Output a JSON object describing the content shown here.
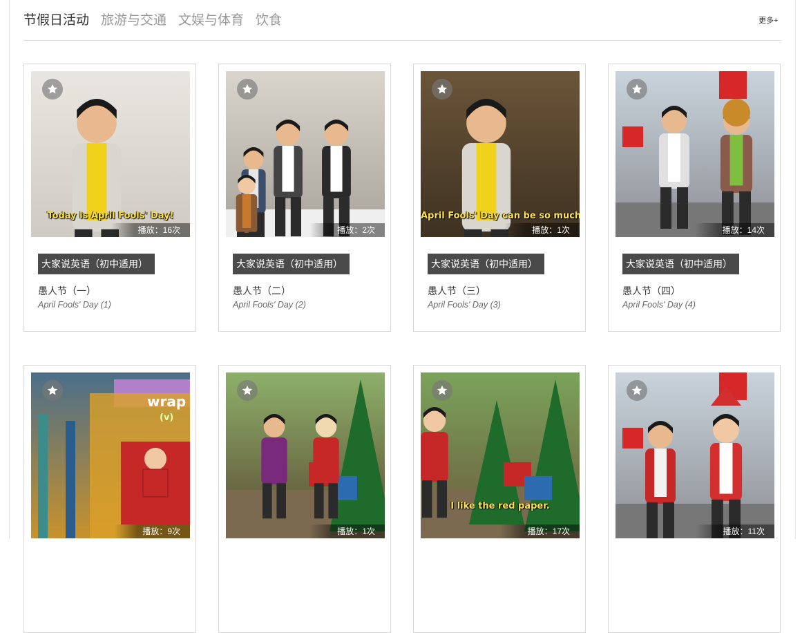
{
  "tabs": [
    "节假日活动",
    "旅游与交通",
    "文娱与体育",
    "饮食"
  ],
  "more_label": "更多+",
  "play_label": "播放：",
  "cards": [
    {
      "series": "大家说英语（初中适用）",
      "title": "愚人节（一）",
      "subtitle": "April Fools' Day (1)",
      "plays": "16次",
      "caption": "Today is April Fools' Day!",
      "scene": "presenter-white",
      "accent": "#e8c61a"
    },
    {
      "series": "大家说英语（初中适用）",
      "title": "愚人节（二）",
      "subtitle": "April Fools' Day (2)",
      "plays": "2次",
      "caption": "",
      "scene": "office-dance",
      "accent": "#d0ccc5"
    },
    {
      "series": "大家说英语（初中适用）",
      "title": "愚人节（三）",
      "subtitle": "April Fools' Day (3)",
      "plays": "1次",
      "caption": "April Fools' Day can be so much fu",
      "scene": "presenter-jungle",
      "accent": "#7a5a3a"
    },
    {
      "series": "大家说英语（初中适用）",
      "title": "愚人节（四）",
      "subtitle": "April Fools' Day (4)",
      "plays": "14次",
      "caption": "",
      "scene": "clown-street",
      "accent": "#c0392b"
    },
    {
      "series": "",
      "title": "",
      "subtitle": "",
      "plays": "9次",
      "caption": "",
      "scene": "wrap-studio",
      "accent": "#d89a2a",
      "overlay_text": "wrap",
      "overlay_sub": "(v)"
    },
    {
      "series": "",
      "title": "",
      "subtitle": "",
      "plays": "1次",
      "caption": "",
      "scene": "christmas-jungle",
      "accent": "#2e7d32"
    },
    {
      "series": "",
      "title": "",
      "subtitle": "",
      "plays": "17次",
      "caption": "I like the red paper.",
      "scene": "christmas-tree",
      "accent": "#2e7d32"
    },
    {
      "series": "",
      "title": "",
      "subtitle": "",
      "plays": "11次",
      "caption": "",
      "scene": "santa-street",
      "accent": "#c62828"
    }
  ]
}
